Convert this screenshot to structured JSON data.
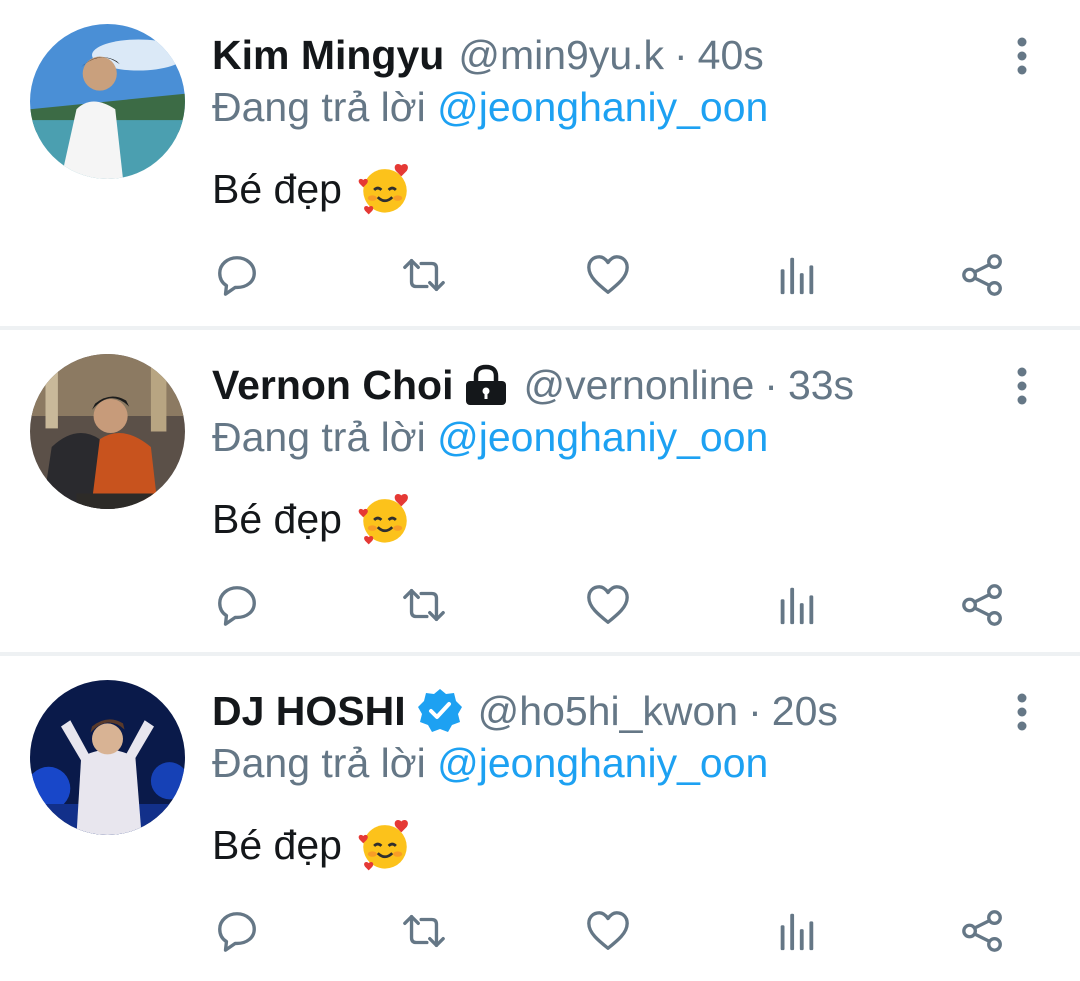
{
  "tweets": [
    {
      "name": "Kim Mingyu",
      "handle": "@min9yu.k",
      "dot": "·",
      "time": "40s",
      "reply_prefix": "Đang trả lời ",
      "reply_to": "@jeonghaniy_oon",
      "text": "Bé đẹp",
      "emoji": "smiling-face-with-hearts",
      "badge": null
    },
    {
      "name": "Vernon Choi",
      "handle": "@vernonline",
      "dot": "·",
      "time": "33s",
      "reply_prefix": "Đang trả lời ",
      "reply_to": "@jeonghaniy_oon",
      "text": "Bé đẹp",
      "emoji": "smiling-face-with-hearts",
      "badge": "lock-icon"
    },
    {
      "name": "DJ HOSHI",
      "handle": "@ho5hi_kwon",
      "dot": "·",
      "time": "20s",
      "reply_prefix": "Đang trả lời ",
      "reply_to": "@jeonghaniy_oon",
      "text": "Bé đẹp",
      "emoji": "smiling-face-with-hearts",
      "badge": "verified-badge-icon"
    }
  ],
  "icons": {
    "reply": "reply-icon",
    "retweet": "retweet-icon",
    "like": "heart-icon",
    "analytics": "analytics-icon",
    "share": "share-icon",
    "more": "more-vertical-icon"
  },
  "colors": {
    "text": "#14171a",
    "muted": "#657786",
    "accent": "#1da1f2",
    "divider": "#eef1f3"
  }
}
